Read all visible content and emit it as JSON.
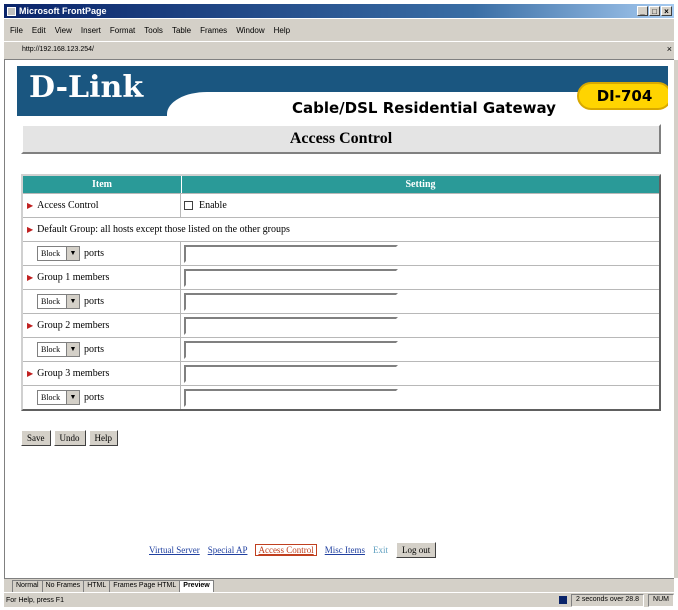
{
  "window": {
    "title": "Microsoft FrontPage",
    "controls": [
      "_",
      "□",
      "×"
    ]
  },
  "menubar": [
    "File",
    "Edit",
    "View",
    "Insert",
    "Format",
    "Tools",
    "Table",
    "Frames",
    "Window",
    "Help"
  ],
  "urlbar": {
    "url": "http://192.168.123.254/"
  },
  "banner": {
    "logo": "D-Link",
    "tagline": "Cable/DSL Residential Gateway",
    "model": "DI-704"
  },
  "page_title": "Access Control",
  "table": {
    "header_item": "Item",
    "header_setting": "Setting",
    "access_control": {
      "label": "Access Control",
      "enable_label": "Enable",
      "checked": false
    },
    "default_group": "Default Group: all hosts except those listed on the other groups",
    "block_option": "Block",
    "ports_label": "ports",
    "group1_label": "Group 1 members",
    "group2_label": "Group 2 members",
    "group3_label": "Group 3 members"
  },
  "buttons": {
    "save": "Save",
    "undo": "Undo",
    "help": "Help"
  },
  "footer": {
    "virtual_server": "Virtual Server",
    "special_ap": "Special AP",
    "access_control": "Access Control",
    "misc_items": "Misc Items",
    "exit": "Exit",
    "log_out": "Log out"
  },
  "tabs": [
    "Normal",
    "No Frames",
    "HTML",
    "Frames Page HTML",
    "Preview"
  ],
  "status": {
    "left": "For Help, press F1",
    "time": "2 seconds over 28.8",
    "mode": "NUM"
  }
}
